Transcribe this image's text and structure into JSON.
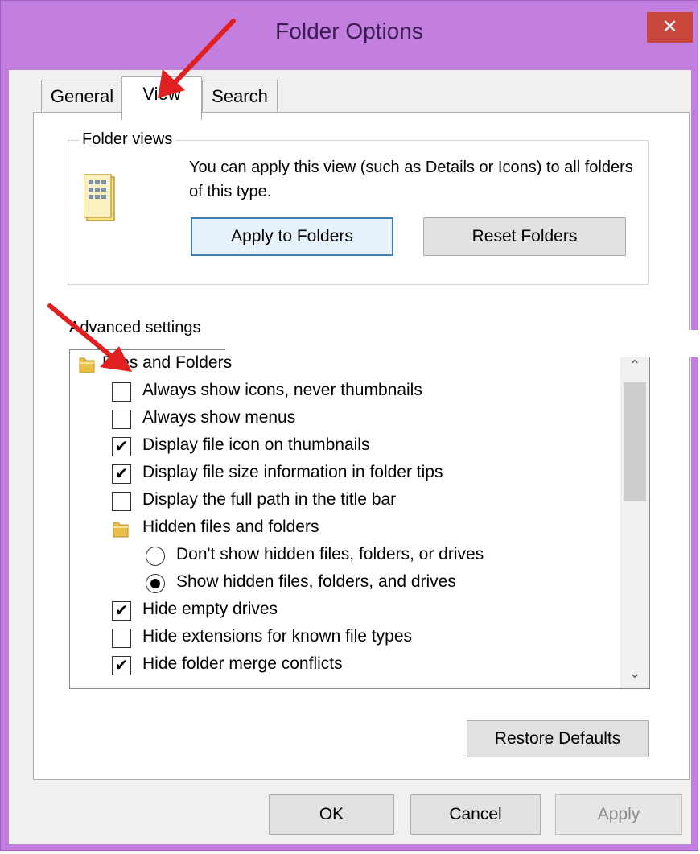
{
  "window": {
    "title": "Folder Options",
    "close_label": "✕"
  },
  "tabs": [
    {
      "label": "General",
      "active": false
    },
    {
      "label": "View",
      "active": true
    },
    {
      "label": "Search",
      "active": false
    }
  ],
  "folder_views": {
    "legend": "Folder views",
    "description": "You can apply this view (such as Details or Icons) to all folders of this type.",
    "apply_button": "Apply to Folders",
    "reset_button": "Reset Folders"
  },
  "advanced": {
    "label": "Advanced settings",
    "items": [
      {
        "kind": "folder",
        "label": "Files and Folders",
        "level": 0
      },
      {
        "kind": "checkbox",
        "label": "Always show icons, never thumbnails",
        "checked": false,
        "level": 1
      },
      {
        "kind": "checkbox",
        "label": "Always show menus",
        "checked": false,
        "level": 1
      },
      {
        "kind": "checkbox",
        "label": "Display file icon on thumbnails",
        "checked": true,
        "level": 1
      },
      {
        "kind": "checkbox",
        "label": "Display file size information in folder tips",
        "checked": true,
        "level": 1
      },
      {
        "kind": "checkbox",
        "label": "Display the full path in the title bar",
        "checked": false,
        "level": 1
      },
      {
        "kind": "folder",
        "label": "Hidden files and folders",
        "level": 1
      },
      {
        "kind": "radio",
        "label": "Don't show hidden files, folders, or drives",
        "checked": false,
        "level": 2
      },
      {
        "kind": "radio",
        "label": "Show hidden files, folders, and drives",
        "checked": true,
        "level": 2
      },
      {
        "kind": "checkbox",
        "label": "Hide empty drives",
        "checked": true,
        "level": 1
      },
      {
        "kind": "checkbox",
        "label": "Hide extensions for known file types",
        "checked": false,
        "level": 1
      },
      {
        "kind": "checkbox",
        "label": "Hide folder merge conflicts",
        "checked": true,
        "level": 1
      }
    ],
    "scroll_up": "⌃",
    "scroll_down": "⌄",
    "check_glyph": "✔"
  },
  "buttons": {
    "restore_defaults": "Restore Defaults",
    "ok": "OK",
    "cancel": "Cancel",
    "apply": "Apply"
  },
  "colors": {
    "title_bar": "#c27fe0",
    "close_button": "#c9463d",
    "annotation_arrow": "#e02020",
    "focus_border": "#3c7fb1"
  },
  "icons": {
    "folder_large": "folder-view-icon",
    "folder_small": "folder-icon",
    "annotation": "red-arrow"
  }
}
